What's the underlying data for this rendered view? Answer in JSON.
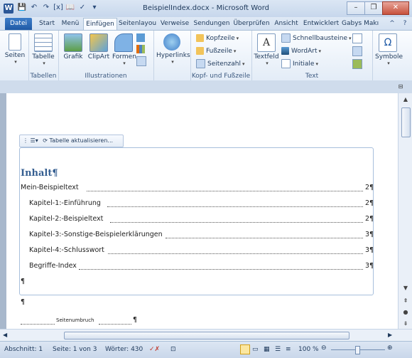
{
  "window": {
    "title": "BeispielIndex.docx - Microsoft Word"
  },
  "tabs": [
    "Datei",
    "Start",
    "Menü",
    "Einfügen",
    "Seitenlayou",
    "Verweise",
    "Sendungen",
    "Überprüfen",
    "Ansicht",
    "Entwicklert",
    "Gabys Makı"
  ],
  "ribbon": {
    "seiten": "Seiten",
    "tabelle": "Tabelle",
    "group_tabellen": "Tabellen",
    "grafik": "Grafik",
    "clipart": "ClipArt",
    "formen": "Formen",
    "group_illustrationen": "Illustrationen",
    "hyperlinks": "Hyperlinks",
    "kopfzeile": "Kopfzeile",
    "fusszeile": "Fußzeile",
    "seitenzahl": "Seitenzahl",
    "group_kopf": "Kopf- und Fußzeile",
    "textfeld": "Textfeld",
    "schnellbausteine": "Schnellbausteine",
    "wordart": "WordArt",
    "initiale": "Initiale",
    "group_text": "Text",
    "symbole": "Symbole"
  },
  "toc": {
    "toolbar_label": "Tabelle aktualisieren...",
    "heading": "Inhalt¶",
    "entries": [
      {
        "text": "Mein-Beispieltext",
        "page": "2¶"
      },
      {
        "text": "Kapitel-1:-Einführung",
        "page": "2¶"
      },
      {
        "text": "Kapitel-2:-Beispieltext",
        "page": "2¶"
      },
      {
        "text": "Kapitel-3:-Sonstige-Beispielerklärungen",
        "page": "3¶"
      },
      {
        "text": "Kapitel-4:-Schlusswort",
        "page": "3¶"
      },
      {
        "text": "Begriffe-Index",
        "page": "3¶"
      }
    ],
    "para_mark": "¶",
    "para_mark2": "¶",
    "page_break": "Seitenumbruch",
    "page_break_mark": "¶"
  },
  "status": {
    "abschnitt": "Abschnitt: 1",
    "seite": "Seite: 1 von 3",
    "woerter": "Wörter: 430",
    "zoom": "100 %"
  }
}
